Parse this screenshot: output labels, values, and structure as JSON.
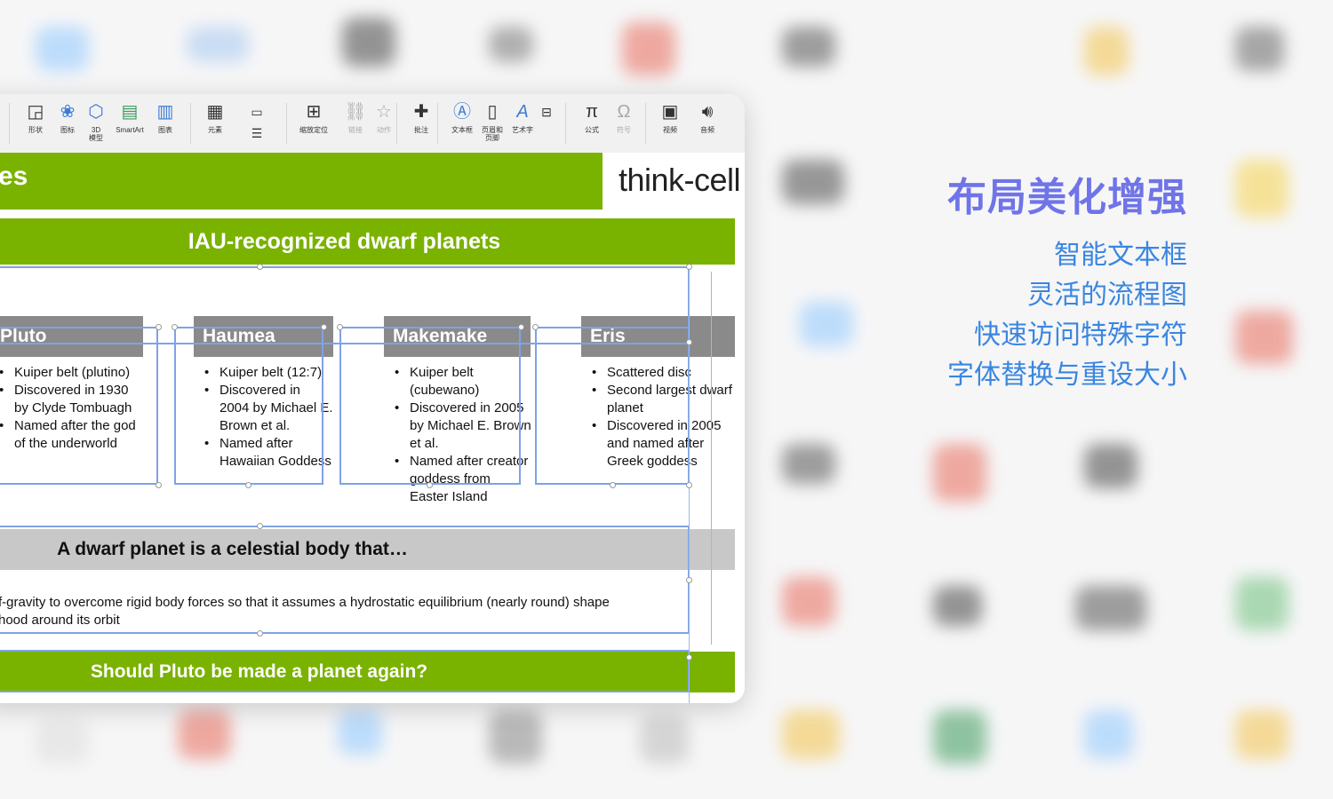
{
  "marketing": {
    "headline": "布局美化增强",
    "features": [
      "智能文本框",
      "灵活的流程图",
      "快速访问特殊字符",
      "字体替换与重设大小"
    ]
  },
  "toolbar": {
    "items": [
      {
        "label": "形状",
        "icon": "shape-icon"
      },
      {
        "label": "图标",
        "icon": "icons-icon"
      },
      {
        "label": "3D\n模型",
        "icon": "cube-icon"
      },
      {
        "label": "SmartArt",
        "icon": "smartart-icon"
      },
      {
        "label": "图表",
        "icon": "chart-icon"
      },
      {
        "label": "元素",
        "icon": "elements-icon"
      },
      {
        "label": "缩放定位",
        "icon": "zoom-icon"
      },
      {
        "label": "链接",
        "icon": "link-icon",
        "disabled": true
      },
      {
        "label": "动作",
        "icon": "action-icon",
        "disabled": true
      },
      {
        "label": "批注",
        "icon": "comment-icon"
      },
      {
        "label": "文本框",
        "icon": "textbox-icon"
      },
      {
        "label": "页眉和\n页脚",
        "icon": "header-footer-icon"
      },
      {
        "label": "艺术字",
        "icon": "wordart-icon"
      },
      {
        "label": "公式",
        "icon": "equation-icon"
      },
      {
        "label": "符号",
        "icon": "symbol-icon",
        "disabled": true
      },
      {
        "label": "视频",
        "icon": "video-icon"
      },
      {
        "label": "音频",
        "icon": "audio-icon"
      }
    ]
  },
  "slide": {
    "title": "es",
    "logo": "think-cell",
    "section_title": "IAU-recognized dwarf planets",
    "columns": [
      {
        "name": "Pluto",
        "bullets": [
          "Kuiper belt (plutino)",
          "Discovered in 1930 by Clyde Tombuagh",
          "Named after the god of the underworld"
        ]
      },
      {
        "name": "Haumea",
        "bullets": [
          "Kuiper belt (12:7)",
          "Discovered in 2004 by Michael E. Brown et al.",
          "Named after Hawaiian Goddess"
        ]
      },
      {
        "name": "Makemake",
        "bullets": [
          "Kuiper belt (cubewano)",
          "Discovered in 2005 by Michael E. Brown et al.",
          "Named after creator goddess from Easter Island"
        ]
      },
      {
        "name": "Eris",
        "bullets": [
          "Scattered disc",
          "Second largest dwarf planet",
          "Discovered in 2005 and named after Greek goddess"
        ]
      }
    ],
    "definition_title": "A dwarf planet is a celestial body that…",
    "definition_lines": [
      "f-gravity to overcome rigid body forces so that it assumes a hydrostatic equilibrium (nearly round) shape",
      "hood around its orbit"
    ],
    "question": "Should Pluto be made a planet again?"
  },
  "colors": {
    "slide_green": "#7ab200",
    "header_gray": "#8a8a8a",
    "headline_purple": "#6f74e8",
    "feature_blue": "#3a86e0",
    "selection_blue": "#7ea2e6"
  }
}
